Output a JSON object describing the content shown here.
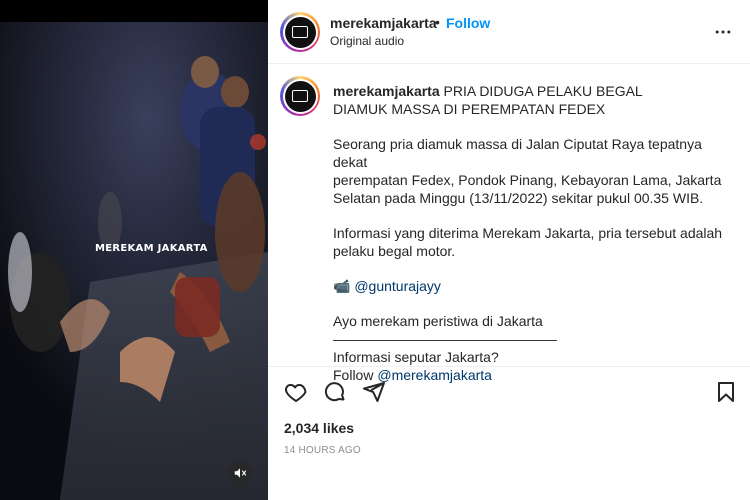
{
  "video": {
    "watermark": "MEREKAM JAKARTA",
    "mute_icon": "speaker-muted-icon"
  },
  "header": {
    "username": "merekamjakarta",
    "separator": "•",
    "follow_label": "Follow",
    "audio_label": "Original audio",
    "more_icon": "more-options-icon"
  },
  "caption": {
    "username": "merekamjakarta",
    "title_line1": "PRIA DIDUGA PELAKU BEGAL",
    "title_line2": "DIAMUK MASSA DI PEREMPATAN FEDEX",
    "para1_line1": "Seorang pria diamuk massa di Jalan Ciputat Raya tepatnya dekat",
    "para1_line2": "perempatan Fedex, Pondok Pinang, Kebayoran Lama, Jakarta",
    "para1_line3": "Selatan pada Minggu (13/11/2022) sekitar pukul 00.35 WIB.",
    "para2_line1": "Informasi yang diterima Merekam Jakarta, pria tersebut adalah",
    "para2_line2": "pelaku begal motor.",
    "credit_emoji": "📹",
    "credit_handle": "@gunturajayy",
    "cta": "Ayo merekam peristiwa di Jakarta",
    "rule": "————————————————",
    "question": "Informasi seputar Jakarta?",
    "follow_prefix": "Follow ",
    "follow_handle": "@merekamjakarta"
  },
  "actions": {
    "like_icon": "heart-icon",
    "comment_icon": "comment-icon",
    "share_icon": "send-icon",
    "save_icon": "bookmark-icon"
  },
  "likes": "2,034 likes",
  "timestamp": "14 HOURS AGO",
  "colors": {
    "follow": "#0095f6",
    "link": "#00376b",
    "text": "#262626",
    "muted": "#8e8e8e"
  }
}
